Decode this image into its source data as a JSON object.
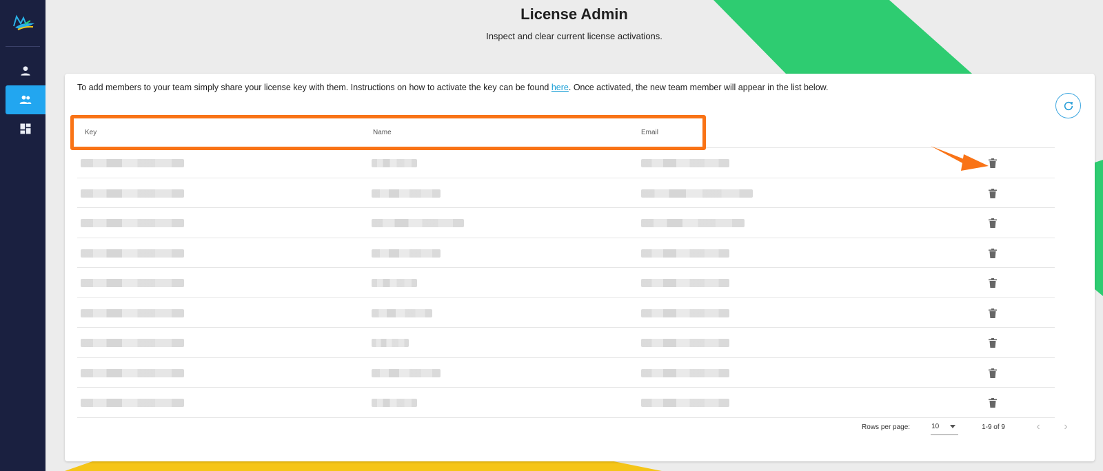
{
  "header": {
    "title": "License Admin",
    "subtitle": "Inspect and clear current license activations."
  },
  "sidebar": {
    "items": [
      {
        "icon": "person-icon",
        "active": false
      },
      {
        "icon": "group-icon",
        "active": true
      },
      {
        "icon": "dashboard-icon",
        "active": false
      }
    ]
  },
  "card": {
    "intro_before": "To add members to your team simply share your license key with them. Instructions on how to activate the key can be found ",
    "intro_link": "here",
    "intro_after": ". Once activated, the new team member will appear in the list below."
  },
  "table": {
    "columns": [
      "Key",
      "Name",
      "Email"
    ],
    "rows": [
      {
        "key": "",
        "name": "",
        "email": ""
      },
      {
        "key": "",
        "name": "",
        "email": ""
      },
      {
        "key": "",
        "name": "",
        "email": ""
      },
      {
        "key": "",
        "name": "",
        "email": ""
      },
      {
        "key": "",
        "name": "",
        "email": ""
      },
      {
        "key": "",
        "name": "",
        "email": ""
      },
      {
        "key": "",
        "name": "",
        "email": ""
      },
      {
        "key": "",
        "name": "",
        "email": ""
      },
      {
        "key": "",
        "name": "",
        "email": ""
      }
    ]
  },
  "pagination": {
    "rows_per_page_label": "Rows per page:",
    "rows_per_page": "10",
    "range": "1-9 of 9"
  },
  "colors": {
    "sidebar": "#1a2040",
    "accent": "#22a6f0",
    "highlight": "#f97316",
    "green": "#2ecc71",
    "yellow": "#f5c518"
  }
}
